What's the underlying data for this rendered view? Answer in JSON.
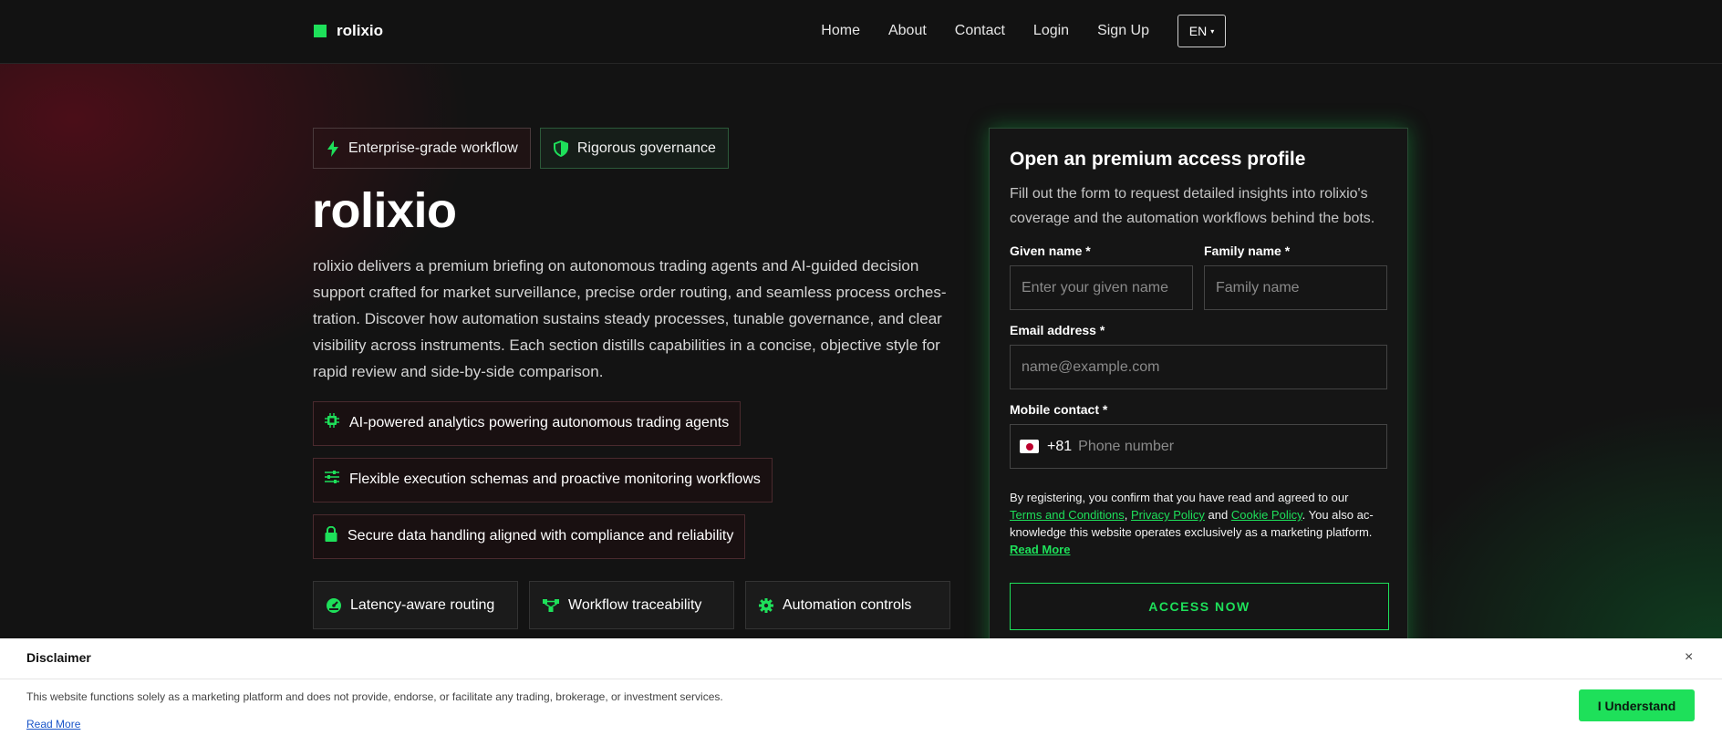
{
  "brand": {
    "name": "rolixio",
    "accent": "#1ee05a"
  },
  "nav": {
    "links": [
      "Home",
      "About",
      "Contact",
      "Login",
      "Sign Up"
    ],
    "language": "EN"
  },
  "hero": {
    "tags": [
      "Enterprise-grade workflow",
      "Rigorous governance"
    ],
    "title": "rolixio",
    "description": "rolixio delivers a premium briefing on autonomous trading agents and AI-guided decision support crafted for market surveillance, precise order routing, and seamless process orches-tration. Discover how automation sustains steady processes, tunable governance, and clear visibility across instruments. Each section distills capabilities in a concise, objective style for rapid review and side-by-side comparison.",
    "features": [
      {
        "label": "AI-powered analytics powering autonomous trading agents",
        "icon": "chip-icon"
      },
      {
        "label": "Flexible execution schemas and proactive monitoring workflows",
        "icon": "sliders-icon"
      },
      {
        "label": "Secure data handling aligned with compliance and reliability",
        "icon": "lock-icon"
      }
    ],
    "chips": [
      {
        "label": "Latency-aware routing",
        "icon": "gauge-icon"
      },
      {
        "label": "Workflow traceability",
        "icon": "network-icon"
      },
      {
        "label": "Automation controls",
        "icon": "gear-icon"
      }
    ]
  },
  "form": {
    "title": "Open an premium access profile",
    "subtitle": "Fill out the form to request detailed insights into rolixio's coverage and the automation workflows behind the bots.",
    "given_label": "Given name *",
    "given_placeholder": "Enter your given name",
    "family_label": "Family name *",
    "family_placeholder": "Family name",
    "email_label": "Email address *",
    "email_placeholder": "name@example.com",
    "mobile_label": "Mobile contact *",
    "dial_code": "+81",
    "phone_placeholder": "Phone number",
    "legal_prefix": "By registering, you confirm that you have read and agreed to our",
    "terms": "Terms and Conditions",
    "privacy": "Privacy Policy",
    "and": "and",
    "cookie": "Cookie Policy",
    "legal_suffix": ". You also ac-knowledge this website operates exclusively as a marketing platform.",
    "read_more": "Read More",
    "submit": "ACCESS NOW"
  },
  "disclaimer": {
    "title": "Disclaimer",
    "close": "×",
    "text": "This website functions solely as a marketing platform and does not provide, endorse, or facilitate any trading, brokerage, or investment services.",
    "read_more": "Read More",
    "button": "I Understand"
  }
}
